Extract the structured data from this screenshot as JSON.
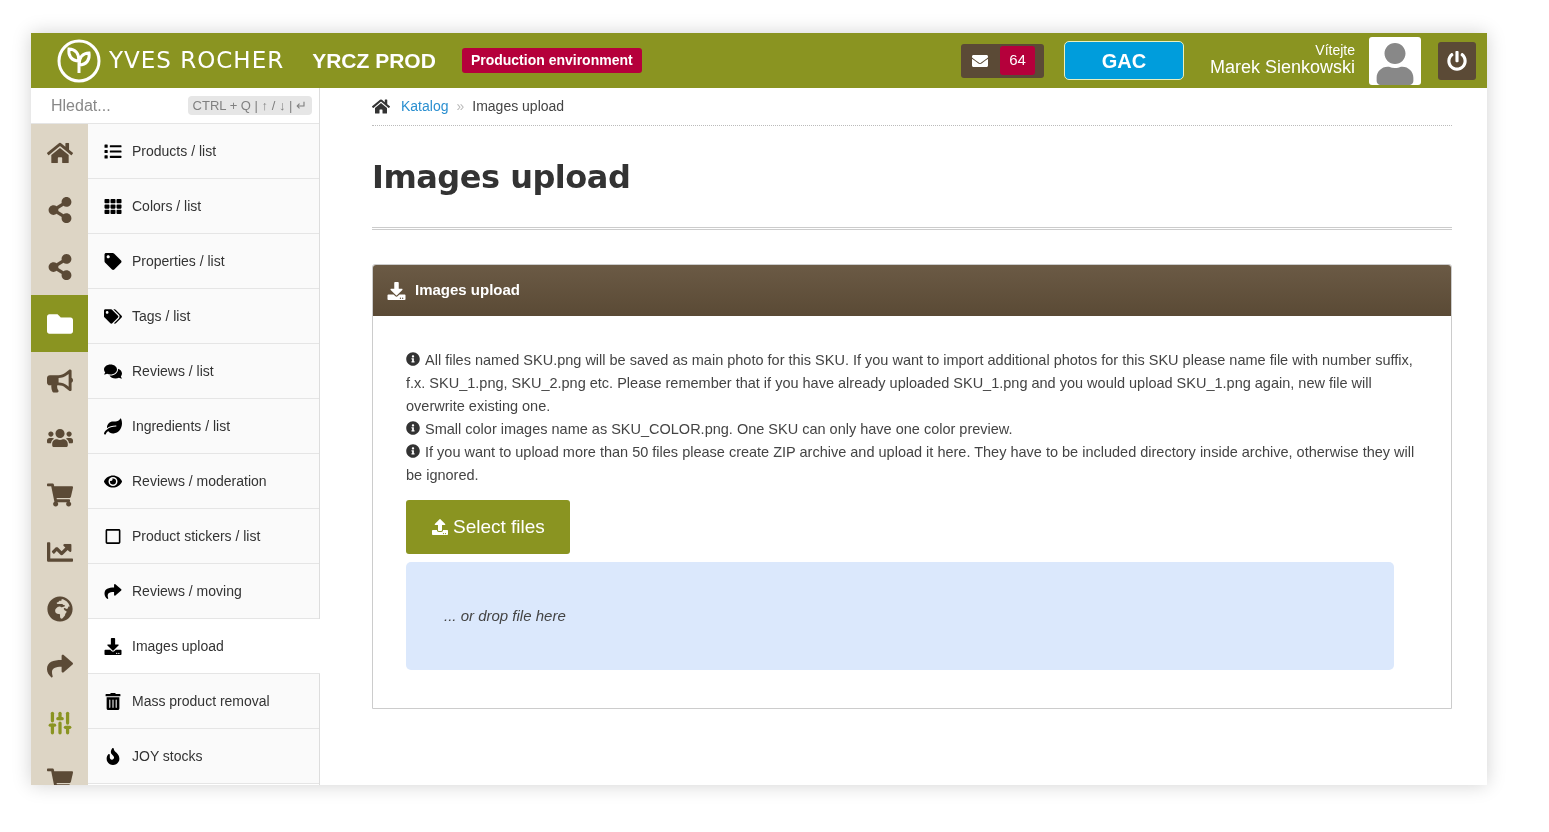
{
  "header": {
    "brand": "YVES ROCHER",
    "instance": "YRCZ PROD",
    "environment_badge": "Production environment",
    "messages_count": "64",
    "gac_button": "GAC",
    "greeting": "Vítejte",
    "user_name": "Marek Sienkowski"
  },
  "search": {
    "placeholder": "Hledat...",
    "shortcut_hint": "CTRL + Q | ↑ / ↓ | ↵"
  },
  "icon_rail": [
    {
      "selected": false
    },
    {
      "selected": false
    },
    {
      "selected": false
    },
    {
      "selected": true
    },
    {
      "selected": false
    },
    {
      "selected": false
    },
    {
      "selected": false
    },
    {
      "selected": false
    },
    {
      "selected": false
    },
    {
      "selected": false
    },
    {
      "selected": false
    },
    {
      "selected": false
    }
  ],
  "menu": [
    {
      "label": "Products / list",
      "selected": false
    },
    {
      "label": "Colors / list",
      "selected": false
    },
    {
      "label": "Properties / list",
      "selected": false
    },
    {
      "label": "Tags / list",
      "selected": false
    },
    {
      "label": "Reviews / list",
      "selected": false
    },
    {
      "label": "Ingredients / list",
      "selected": false
    },
    {
      "label": "Reviews / moderation",
      "selected": false
    },
    {
      "label": "Product stickers / list",
      "selected": false
    },
    {
      "label": "Reviews / moving",
      "selected": false
    },
    {
      "label": "Images upload",
      "selected": true
    },
    {
      "label": "Mass product removal",
      "selected": false
    },
    {
      "label": "JOY stocks",
      "selected": false
    }
  ],
  "breadcrumb": {
    "link": "Katalog",
    "separator": "»",
    "current": "Images upload"
  },
  "page_title": "Images upload",
  "panel": {
    "title": "Images upload",
    "notes": [
      "All files named SKU.png will be saved as main photo for this SKU. If you want to import additional photos for this SKU please name file with number suffix, f.x. SKU_1.png, SKU_2.png etc. Please remember that if you have already uploaded SKU_1.png and you would upload SKU_1.png again, new file will overwrite existing one.",
      "Small color images name as SKU_COLOR.png. One SKU can only have one color preview.",
      "If you want to upload more than 50 files please create ZIP archive and upload it here. They have to be included directory inside archive, otherwise they will be ignored."
    ],
    "select_button": "Select files",
    "dropzone_text": "... or drop file here"
  }
}
